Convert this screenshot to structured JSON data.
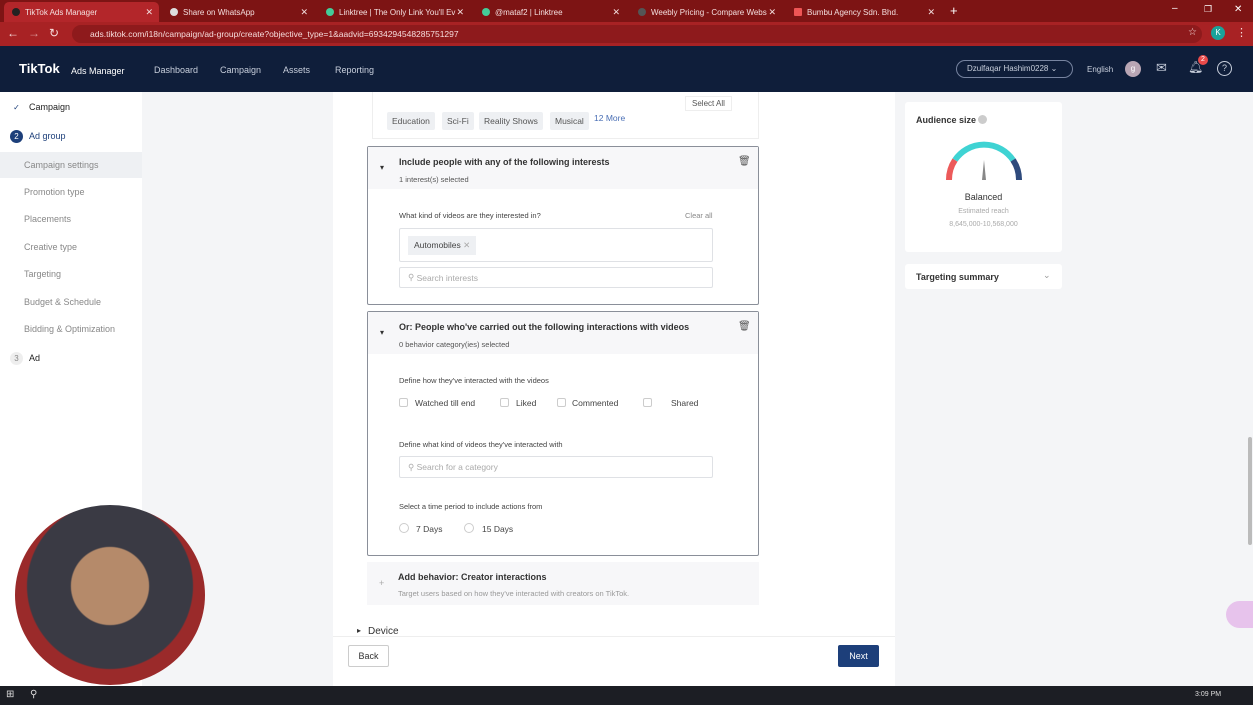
{
  "browser": {
    "tabs": [
      {
        "label": "TikTok Ads Manager",
        "active": true
      },
      {
        "label": "Share on WhatsApp"
      },
      {
        "label": "Linktree | The Only Link You'll Ev"
      },
      {
        "label": "@mataf2 | Linktree"
      },
      {
        "label": "Weebly Pricing - Compare Webs"
      },
      {
        "label": "Bumbu Agency Sdn. Bhd."
      }
    ],
    "url": "ads.tiktok.com/i18n/campaign/ad-group/create?objective_type=1&aadvid=6934294548285751297",
    "profile_initial": "K"
  },
  "header": {
    "logo": "TikTok",
    "logo_sub": "Ads Manager",
    "nav": [
      "Dashboard",
      "Campaign",
      "Assets",
      "Reporting"
    ],
    "account": "Dzulfaqar Hashim0228",
    "language": "English",
    "avatar": "g",
    "notif_count": "2"
  },
  "sidebar": {
    "steps": [
      {
        "num": "✓",
        "label": "Campaign"
      },
      {
        "num": "2",
        "label": "Ad group"
      },
      {
        "num": "3",
        "label": "Ad"
      }
    ],
    "subitems": [
      "Campaign settings",
      "Promotion type",
      "Placements",
      "Creative type",
      "Targeting",
      "Budget & Schedule",
      "Bidding & Optimization"
    ]
  },
  "main": {
    "genre_chips": [
      "Education",
      "Sci-Fi",
      "Reality Shows",
      "Musical"
    ],
    "more": "12 More",
    "select_all": "Select All",
    "interests": {
      "title": "Include people with any of the following interests",
      "subtitle": "1 interest(s) selected",
      "question": "What kind of videos are they interested in?",
      "clear_all": "Clear all",
      "selected": [
        "Automobiles"
      ],
      "search_placeholder": "Search interests"
    },
    "interactions": {
      "title": "Or: People who've carried out the following interactions with videos",
      "subtitle": "0 behavior category(ies) selected",
      "define_how": "Define how they've interacted with the videos",
      "options": [
        "Watched till end",
        "Liked",
        "Commented",
        "Shared"
      ],
      "define_what": "Define what kind of videos they've interacted with",
      "search_placeholder": "Search for a category",
      "period_label": "Select a time period to include actions from",
      "periods": [
        "7 Days",
        "15 Days"
      ]
    },
    "creator": {
      "title": "Add behavior: Creator interactions",
      "subtitle": "Target users based on how they've interacted with creators on TikTok."
    },
    "device": "Device",
    "back": "Back",
    "next": "Next"
  },
  "audience": {
    "title": "Audience size",
    "status": "Balanced",
    "reach_label": "Estimated reach",
    "reach": "8,645,000-10,568,000",
    "gauge_level": 0.5
  },
  "summary": {
    "title": "Targeting summary"
  },
  "taskbar": {
    "time": "3:09 PM"
  },
  "colors": {
    "accent": "#1d3f7a",
    "nav": "#0f1e3a",
    "tabbar": "#7d1414"
  }
}
